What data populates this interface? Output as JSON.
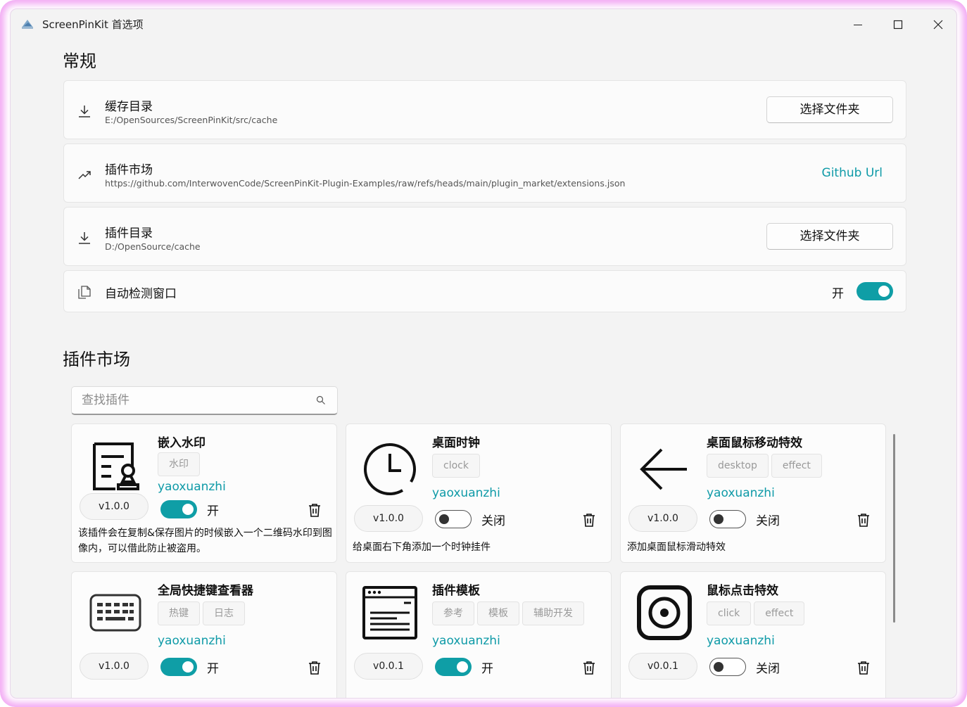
{
  "window": {
    "title": "ScreenPinKit 首选项"
  },
  "general": {
    "title": "常规",
    "cache_dir": {
      "name": "缓存目录",
      "path": "E:/OpenSources/ScreenPinKit/src/cache",
      "button": "选择文件夹"
    },
    "plugin_market": {
      "name": "插件市场",
      "url": "https://github.com/InterwovenCode/ScreenPinKit-Plugin-Examples/raw/refs/heads/main/plugin_market/extensions.json",
      "link": "Github Url"
    },
    "plugin_dir": {
      "name": "插件目录",
      "path": "D:/OpenSource/cache",
      "button": "选择文件夹"
    },
    "auto_detect": {
      "name": "自动检测窗口",
      "state": "开",
      "on": true
    }
  },
  "market": {
    "title": "插件市场",
    "search_placeholder": "查找插件",
    "plugins": [
      {
        "name": "嵌入水印",
        "icon": "watermark-certificate-icon",
        "tags": [
          "水印"
        ],
        "author": "yaoxuanzhi",
        "version": "v1.0.0",
        "enabled": true,
        "state": "开",
        "description": "该插件会在复制&保存图片的时候嵌入一个二维码水印到图像内，可以借此防止被盗用。"
      },
      {
        "name": "桌面时钟",
        "icon": "clock-icon",
        "tags": [
          "clock"
        ],
        "author": "yaoxuanzhi",
        "version": "v1.0.0",
        "enabled": false,
        "state": "关闭",
        "description": "给桌面右下角添加一个时钟挂件"
      },
      {
        "name": "桌面鼠标移动特效",
        "icon": "arrow-left-icon",
        "tags": [
          "desktop",
          "effect"
        ],
        "author": "yaoxuanzhi",
        "version": "v1.0.0",
        "enabled": false,
        "state": "关闭",
        "description": "添加桌面鼠标滑动特效"
      },
      {
        "name": "全局快捷键查看器",
        "icon": "keyboard-icon",
        "tags": [
          "热键",
          "日志"
        ],
        "author": "yaoxuanzhi",
        "version": "v1.0.0",
        "enabled": true,
        "state": "开",
        "description": ""
      },
      {
        "name": "插件模板",
        "icon": "template-window-icon",
        "tags": [
          "参考",
          "模板",
          "辅助开发"
        ],
        "author": "yaoxuanzhi",
        "version": "v0.0.1",
        "enabled": true,
        "state": "开",
        "description": ""
      },
      {
        "name": "鼠标点击特效",
        "icon": "click-target-icon",
        "tags": [
          "click",
          "effect"
        ],
        "author": "yaoxuanzhi",
        "version": "v0.0.1",
        "enabled": false,
        "state": "关闭",
        "description": ""
      }
    ]
  }
}
